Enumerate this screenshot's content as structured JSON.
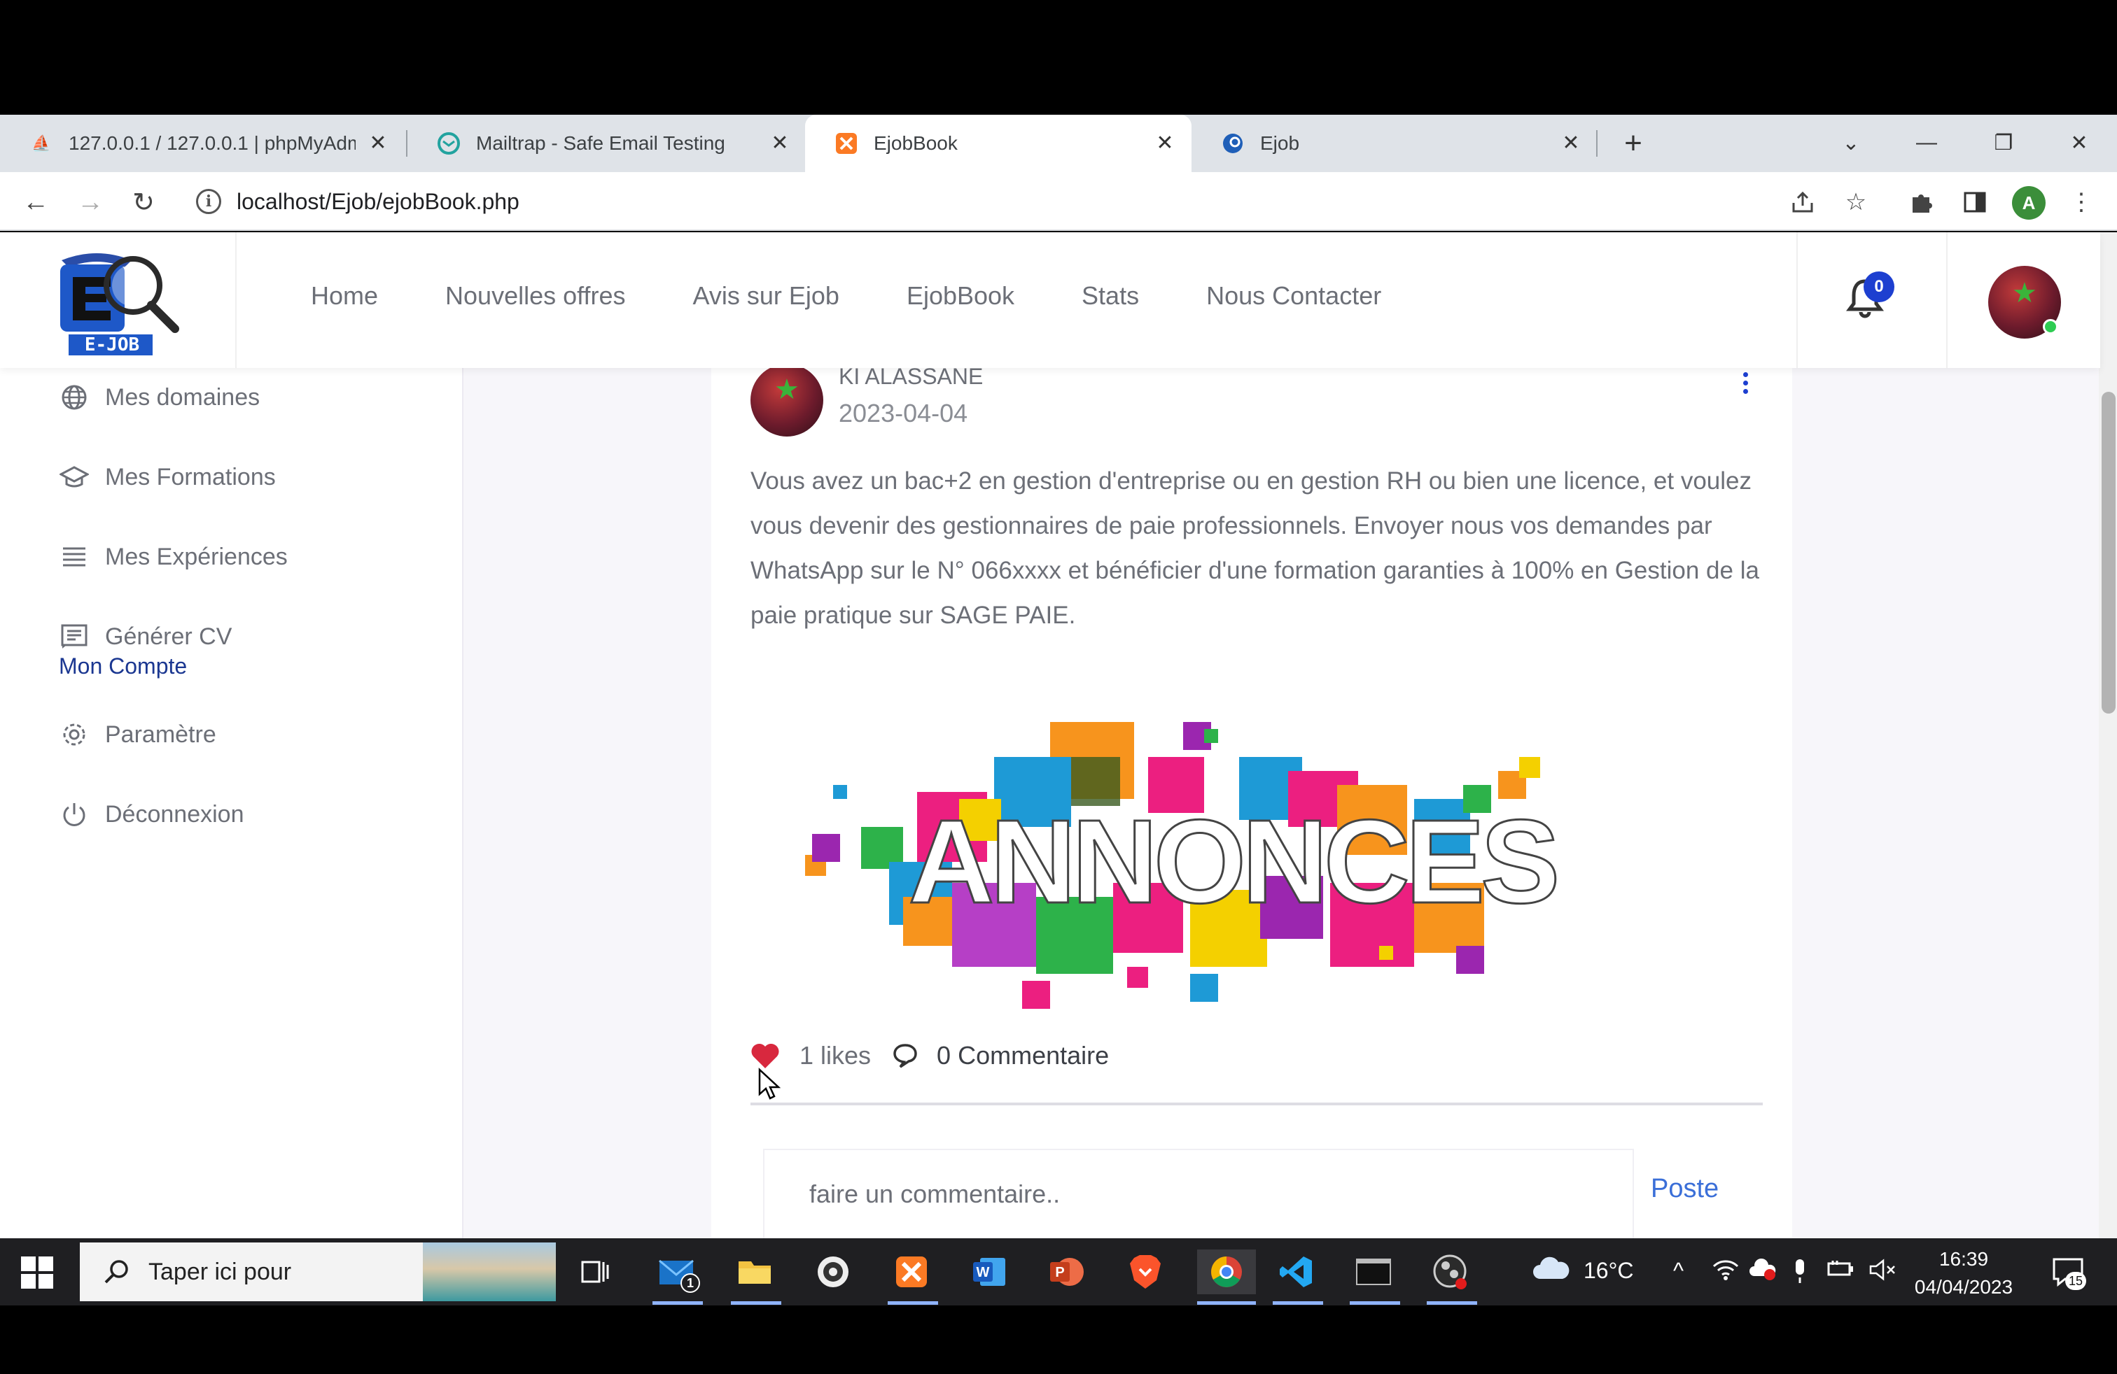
{
  "browser": {
    "tabs": [
      {
        "title": "127.0.0.1 / 127.0.0.1 | phpMyAdmin",
        "icon": "phpmyadmin-icon"
      },
      {
        "title": "Mailtrap - Safe Email Testing",
        "icon": "mailtrap-icon"
      },
      {
        "title": "EjobBook",
        "icon": "xampp-icon",
        "active": true
      },
      {
        "title": "Ejob",
        "icon": "ejob-icon"
      }
    ],
    "url": "localhost/Ejob/ejobBook.php",
    "profile_initial": "A"
  },
  "header": {
    "logo_text": "E-JOB",
    "nav": [
      "Home",
      "Nouvelles offres",
      "Avis sur Ejob",
      "EjobBook",
      "Stats",
      "Nous Contacter"
    ],
    "notification_count": "0"
  },
  "sidebar": {
    "items": [
      {
        "label": "Mes domaines",
        "icon": "globe-icon"
      },
      {
        "label": "Mes Formations",
        "icon": "graduation-cap-icon"
      },
      {
        "label": "Mes Expériences",
        "icon": "list-icon"
      },
      {
        "label": "Générer CV",
        "icon": "document-icon"
      }
    ],
    "section_title": "Mon Compte",
    "account_items": [
      {
        "label": "Paramètre",
        "icon": "gear-icon"
      },
      {
        "label": "Déconnexion",
        "icon": "power-icon"
      }
    ]
  },
  "post": {
    "author": "KI ALASSANE",
    "date": "2023-04-04",
    "text": "Vous avez un bac+2 en gestion d'entreprise ou en gestion RH ou bien une licence, et voulez vous devenir des gestionnaires de paie professionnels. Envoyer nous vos demandes par WhatsApp sur le N° 066xxxx et bénéficier d'une formation garanties à 100% en Gestion de la paie pratique sur SAGE PAIE.",
    "image_text": "ANNONCES",
    "likes": "1 likes",
    "comments": "0 Commentaire",
    "comment_placeholder": "faire un commentaire..",
    "post_button": "Poste"
  },
  "taskbar": {
    "search_placeholder": "Taper ici pour",
    "weather": "16°C",
    "time": "16:39",
    "date": "04/04/2023",
    "mail_badge": "1",
    "notification_count": "15"
  },
  "colors": {
    "accent_blue": "#1b3791",
    "badge_blue": "#1d3fd0",
    "like_red": "#d8283e",
    "link_blue": "#3b6fd8"
  }
}
